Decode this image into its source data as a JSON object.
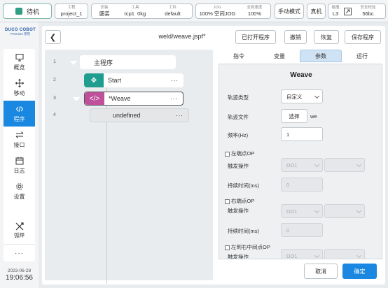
{
  "topbar": {
    "status": "待机",
    "groups": [
      {
        "label": "工程",
        "value": "project_1"
      },
      {
        "label": "安装",
        "value": "盛装"
      },
      {
        "label": "工具",
        "value": "tcp1"
      },
      {
        "label": "",
        "value": "0kg"
      },
      {
        "label": "工件",
        "value": "default"
      }
    ],
    "jog": {
      "label": "JOG",
      "value": "100%"
    },
    "jog_mode": {
      "value": "空间JOG"
    },
    "speed": {
      "label": "全局速度",
      "value": "100%"
    },
    "manual_mode": "手动模式",
    "real_machine": "真机",
    "collision": {
      "label": "碰撞",
      "value": "L3"
    },
    "safety": {
      "label": "安全校验",
      "value": "56bc"
    }
  },
  "sidebar": {
    "logo_line1": "DUCO COBOT",
    "logo_line2": "Premium 系列",
    "items": [
      {
        "label": "概览",
        "icon": "monitor-icon"
      },
      {
        "label": "移动",
        "icon": "move-icon"
      },
      {
        "label": "程序",
        "icon": "code-icon",
        "active": true
      },
      {
        "label": "接口",
        "icon": "swap-icon"
      },
      {
        "label": "日志",
        "icon": "calendar-icon"
      },
      {
        "label": "设置",
        "icon": "gear-icon"
      }
    ],
    "weld_label": "弧焊",
    "more": "···",
    "date": "2023-06-28",
    "time": "19:06:56"
  },
  "editor": {
    "file_title": "weld/weave.jspf*",
    "buttons": {
      "open": "已打开程序",
      "undo": "撤销",
      "redo": "恢复",
      "save": "保存程序"
    },
    "tree": [
      {
        "line": "1",
        "label": "主程序"
      },
      {
        "line": "2",
        "label": "Start",
        "dots": "···"
      },
      {
        "line": "3",
        "label": "*Weave",
        "dots": "···"
      },
      {
        "line": "4",
        "label": "undefined",
        "dots": "···"
      }
    ],
    "tabs": [
      "指令",
      "变量",
      "参数",
      "运行"
    ],
    "active_tab": "参数",
    "colors": {
      "accent": "#1a88e0",
      "start_node": "#1f9e8f",
      "weave_node": "#c0509b"
    }
  },
  "weave": {
    "title": "Weave",
    "track_type_label": "轨迹类型",
    "track_type_value": "自定义",
    "track_file_label": "轨迹文件",
    "track_file_button": "选择",
    "track_file_value": "we",
    "freq_label": "频率(Hz)",
    "freq_value": "1",
    "left_op_label": "左端点OP",
    "trigger_label_1": "触发操作",
    "left_do": "DO1",
    "duration_label_1": "持续时间(ms)",
    "duration_value_1": "0",
    "right_op_label": "右端点OP",
    "trigger_label_2": "触发操作",
    "right_do": "DO1",
    "duration_label_2": "持续时间(ms)",
    "duration_value_2": "0",
    "mid_op_label": "左到右中间点OP",
    "trigger_label_3": "触发操作",
    "mid_do": "DO1"
  },
  "footer": {
    "cancel": "取消",
    "confirm": "确定"
  }
}
